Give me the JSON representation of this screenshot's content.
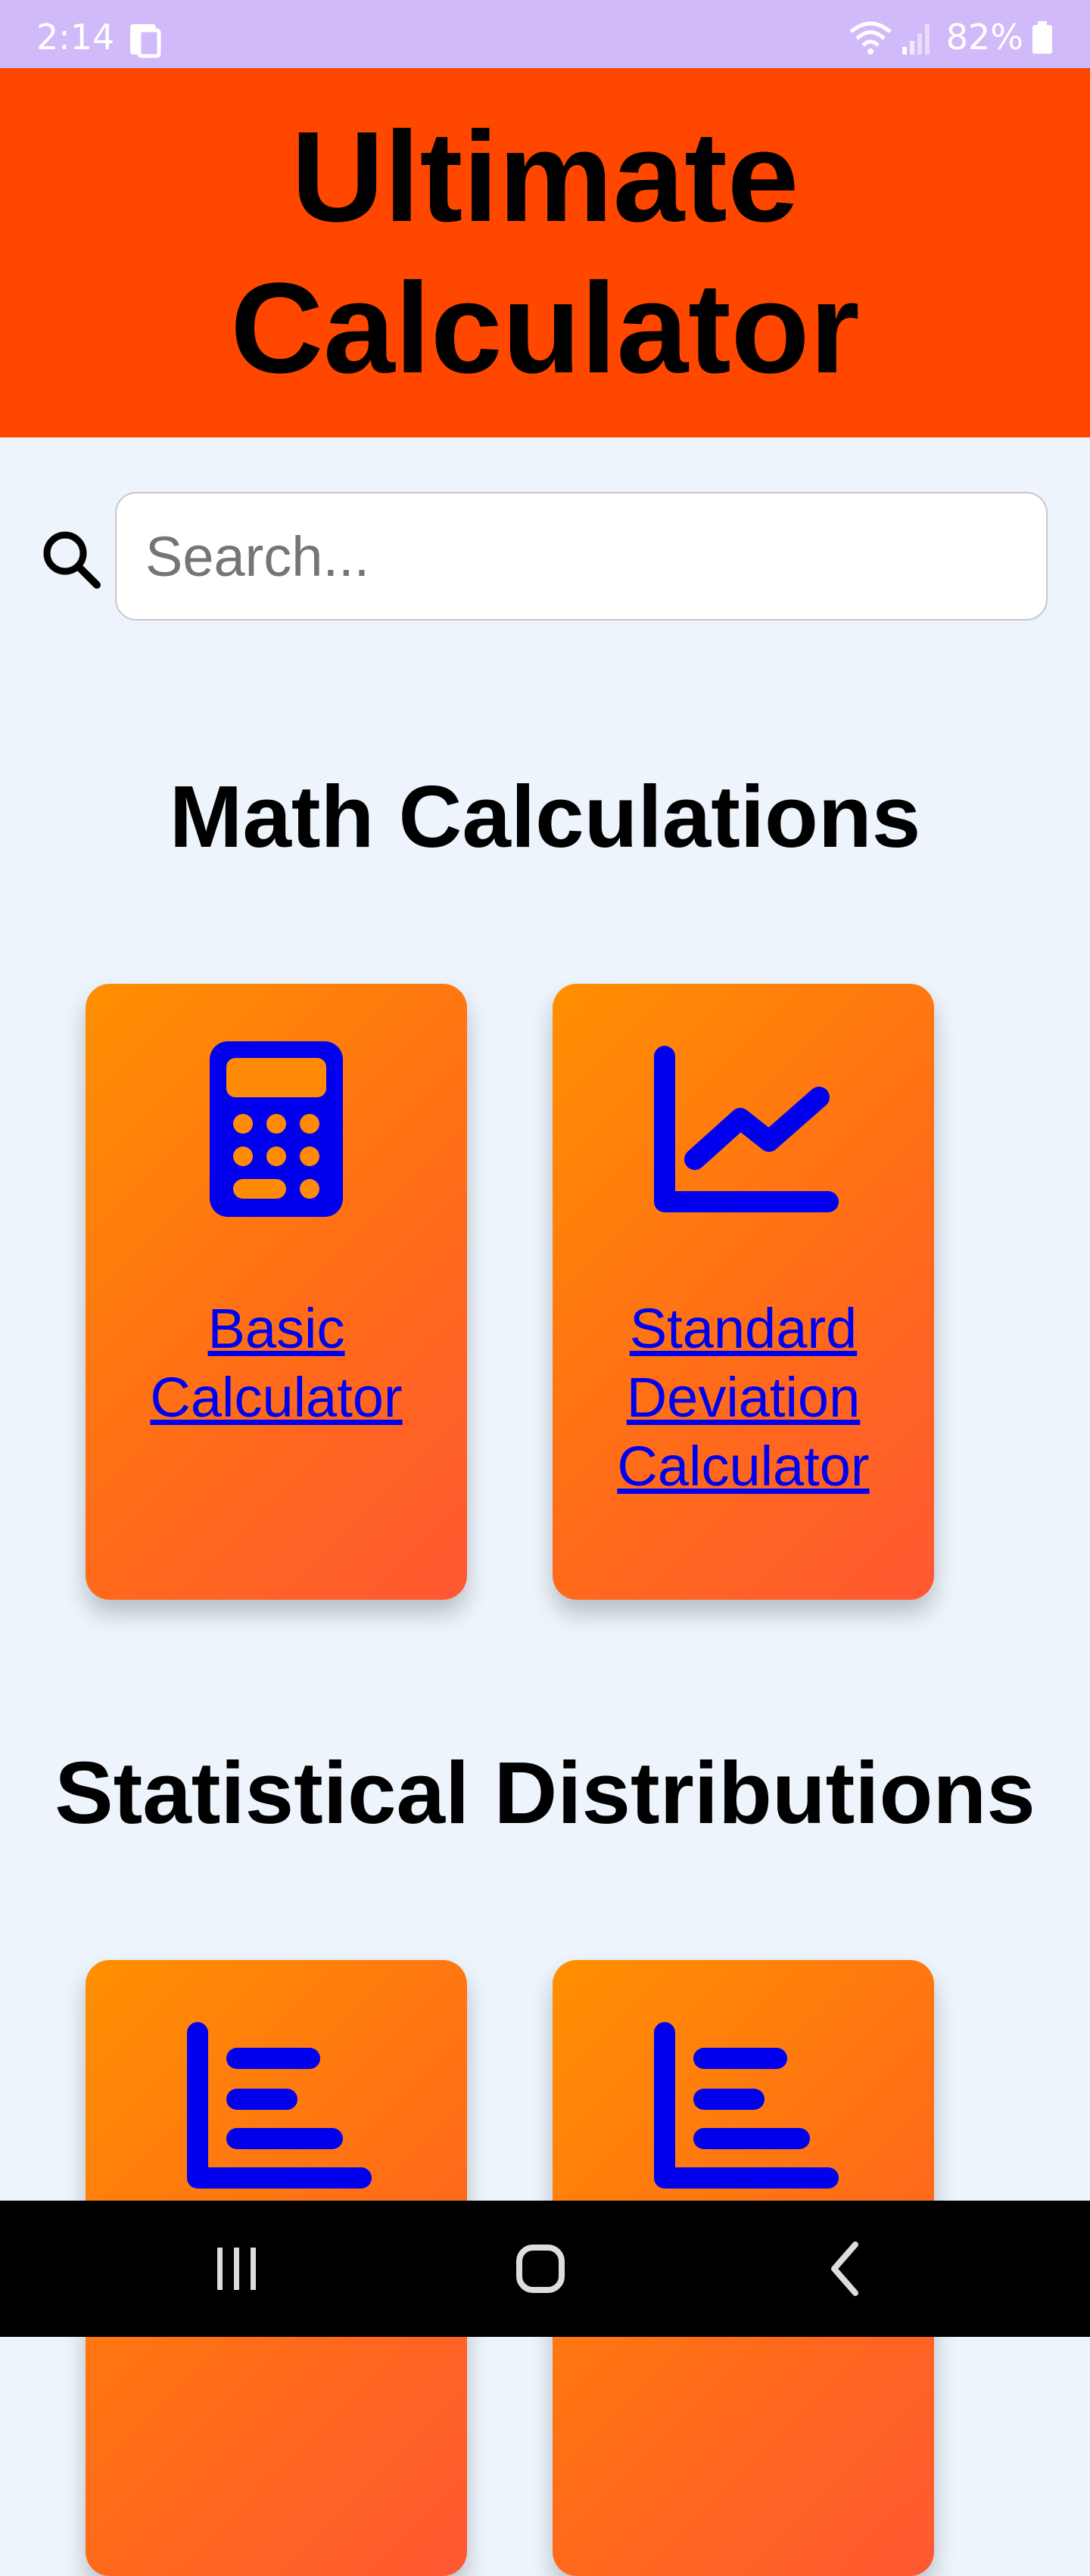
{
  "status_bar": {
    "time": "2:14",
    "left_icon": "phone-card-icon",
    "right_icons": [
      "wifi-icon",
      "signal-icon"
    ],
    "battery_text": "82%",
    "battery_icon": "battery-icon"
  },
  "header": {
    "title": "Ultimate Calculator",
    "background_color": "#ff4700"
  },
  "search": {
    "icon": "search-icon",
    "placeholder": "Search..."
  },
  "sections": [
    {
      "heading": "Math Calculations",
      "cards": [
        {
          "icon": "calculator-icon",
          "label": "Basic Calculator"
        },
        {
          "icon": "line-chart-icon",
          "label": "Standard Deviation Calculator"
        }
      ]
    },
    {
      "heading": "Statistical Distributions",
      "cards": [
        {
          "icon": "bar-chart-icon",
          "label": ""
        },
        {
          "icon": "bar-chart-icon",
          "label": ""
        }
      ]
    }
  ],
  "colors": {
    "card_gradient_start": "#ff8f00",
    "card_gradient_end": "#ff5833",
    "icon_color": "#0000ee",
    "link_color": "#0000ee",
    "page_background": "#edf4fc",
    "status_bar_background": "#d0baf9"
  },
  "nav_bar": {
    "buttons": [
      "recent-apps-icon",
      "home-icon",
      "back-icon"
    ]
  }
}
